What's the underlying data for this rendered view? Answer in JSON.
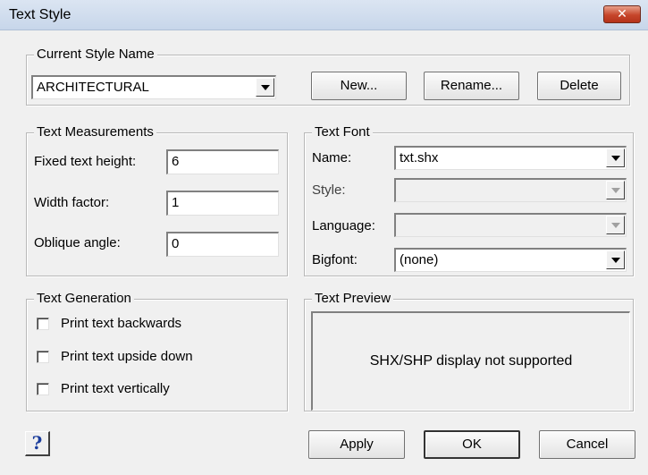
{
  "window": {
    "title": "Text Style",
    "close_glyph": "✕"
  },
  "current_style": {
    "legend": "Current Style Name",
    "selected": "ARCHITECTURAL",
    "new_label": "New...",
    "rename_label": "Rename...",
    "delete_label": "Delete"
  },
  "measurements": {
    "legend": "Text Measurements",
    "fixed_height_label": "Fixed text height:",
    "fixed_height_value": "6",
    "width_factor_label": "Width factor:",
    "width_factor_value": "1",
    "oblique_label": "Oblique angle:",
    "oblique_value": "0"
  },
  "font": {
    "legend": "Text Font",
    "name_label": "Name:",
    "name_value": "txt.shx",
    "style_label": "Style:",
    "style_value": "",
    "language_label": "Language:",
    "language_value": "",
    "bigfont_label": "Bigfont:",
    "bigfont_value": "(none)"
  },
  "generation": {
    "legend": "Text Generation",
    "backwards_label": "Print text backwards",
    "backwards_checked": false,
    "upside_down_label": "Print text upside down",
    "upside_down_checked": false,
    "vertically_label": "Print text vertically",
    "vertically_checked": false
  },
  "preview": {
    "legend": "Text Preview",
    "message": "SHX/SHP display not supported"
  },
  "footer": {
    "help_glyph": "?",
    "apply_label": "Apply",
    "ok_label": "OK",
    "cancel_label": "Cancel"
  },
  "colors": {
    "titlebar": "#c7d6ea",
    "close_button": "#c6452a",
    "help_glyph": "#1a3c9c",
    "dialog_bg": "#f0f0f0"
  },
  "icons": {
    "close": "close-icon",
    "help": "help-icon",
    "dropdown": "chevron-down-icon"
  }
}
